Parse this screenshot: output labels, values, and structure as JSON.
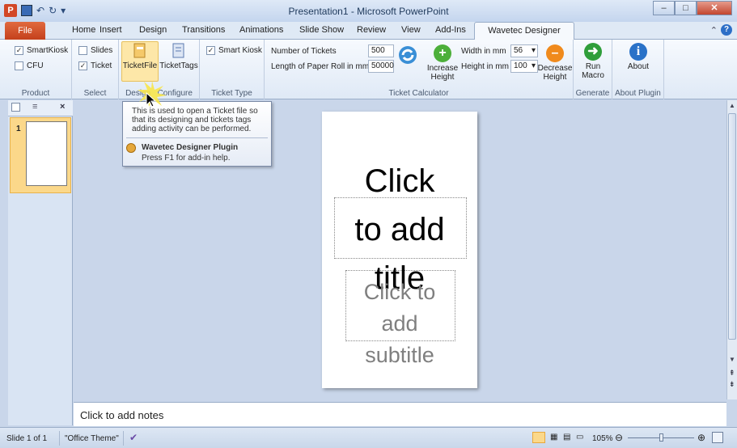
{
  "window": {
    "title": "Presentation1 - Microsoft PowerPoint"
  },
  "tabs": [
    "File",
    "Home",
    "Insert",
    "Design",
    "Transitions",
    "Animations",
    "Slide Show",
    "Review",
    "View",
    "Add-Ins",
    "Wavetec Designer Plugin"
  ],
  "ribbon": {
    "product": {
      "label": "Product",
      "smartkiosk": "SmartKiosk",
      "cfu": "CFU"
    },
    "select": {
      "label": "Select",
      "slides": "Slides",
      "ticket": "Ticket"
    },
    "design": {
      "label": "Design",
      "ticketfile": "TicketFile",
      "tickettags": "TicketTags",
      "configure": "Configure"
    },
    "tickettype": {
      "label": "Ticket Type",
      "smartkiosk": "Smart Kiosk"
    },
    "calculator": {
      "label": "Ticket Calculator",
      "num_tickets_label": "Number of Tickets",
      "num_tickets": "500",
      "paper_label": "Length of Paper Roll in mm",
      "paper": "50000",
      "width_label": "Width in mm",
      "width": "56",
      "height_label": "Height in mm",
      "height": "100",
      "increase": "Increase",
      "increase2": "Height",
      "decrease": "Decrease",
      "decrease2": "Height"
    },
    "generate": {
      "label": "Generate",
      "run": "Run",
      "run2": "Macro"
    },
    "aboutplugin": {
      "label": "About Plugin",
      "about": "About"
    }
  },
  "tooltip": {
    "text1": "This is used to open a Ticket file so",
    "text2": "that its designing and tickets tags",
    "text3": "adding activity can be performed.",
    "plugin": "Wavetec Designer Plugin",
    "help": "Press F1 for add-in help."
  },
  "slides_panel": {
    "slide_num": "1"
  },
  "slide": {
    "title": [
      "Click",
      "to add",
      "title"
    ],
    "subtitle": [
      "Click to",
      "add",
      "subtitle"
    ]
  },
  "notes": "Click to add notes",
  "status": {
    "slide": "Slide 1 of 1",
    "theme": "\"Office Theme\"",
    "zoom": "105%"
  }
}
